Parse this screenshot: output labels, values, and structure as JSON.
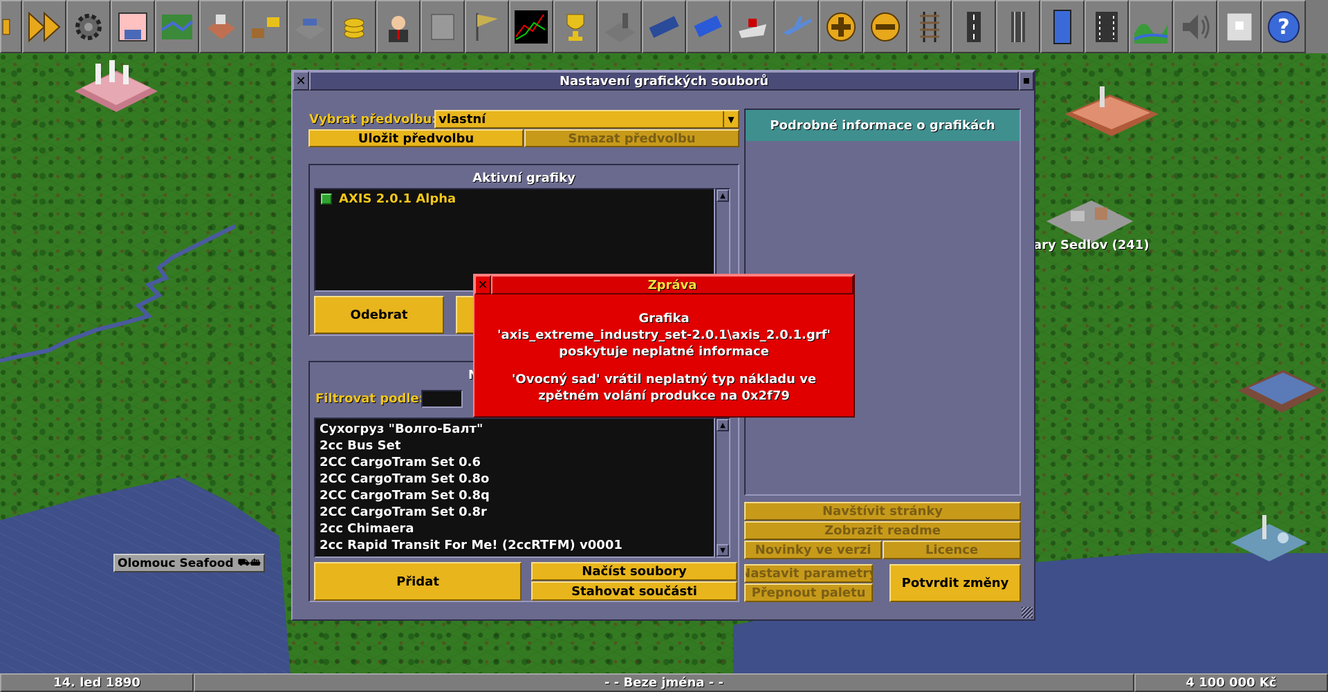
{
  "toolbar": {
    "buttons": [
      {
        "name": "pause-button",
        "icon": "pause-icon"
      },
      {
        "name": "fast-forward-button",
        "icon": "fast-forward-icon"
      },
      {
        "name": "settings-button",
        "icon": "gear-icon"
      },
      {
        "name": "save-button",
        "icon": "floppy-disk-icon"
      },
      {
        "name": "world-map-button",
        "icon": "map-icon"
      },
      {
        "name": "town-directory-button",
        "icon": "town-icon"
      },
      {
        "name": "subsidies-button",
        "icon": "subsidies-icon"
      },
      {
        "name": "station-list-button",
        "icon": "station-icon"
      },
      {
        "name": "finances-button",
        "icon": "coins-icon"
      },
      {
        "name": "company-button",
        "icon": "company-manager-icon"
      },
      {
        "name": "story-book-button",
        "icon": "book-icon"
      },
      {
        "name": "goals-button",
        "icon": "flag-icon"
      },
      {
        "name": "graphs-button",
        "icon": "graph-icon"
      },
      {
        "name": "league-table-button",
        "icon": "trophy-icon"
      },
      {
        "name": "industries-button",
        "icon": "factory-icon"
      },
      {
        "name": "trains-button",
        "icon": "train-icon"
      },
      {
        "name": "road-vehicles-button",
        "icon": "bus-icon"
      },
      {
        "name": "ships-button",
        "icon": "ship-icon"
      },
      {
        "name": "aircraft-button",
        "icon": "airplane-icon"
      },
      {
        "name": "zoom-in-button",
        "icon": "zoom-in-icon"
      },
      {
        "name": "zoom-out-button",
        "icon": "zoom-out-icon"
      },
      {
        "name": "build-railway-button",
        "icon": "rail-track-icon"
      },
      {
        "name": "build-road-button",
        "icon": "road-icon"
      },
      {
        "name": "build-tram-button",
        "icon": "tram-track-icon"
      },
      {
        "name": "build-waterways-button",
        "icon": "canal-icon"
      },
      {
        "name": "build-airport-button",
        "icon": "airport-icon"
      },
      {
        "name": "landscaping-button",
        "icon": "landscape-icon"
      },
      {
        "name": "music-button",
        "icon": "speaker-icon"
      },
      {
        "name": "news-button",
        "icon": "newspaper-icon"
      },
      {
        "name": "help-button",
        "icon": "question-icon"
      }
    ]
  },
  "map": {
    "town_label": "ary Sedlov (241)",
    "industry_label": "Olomouc Seafood"
  },
  "newgrf_window": {
    "title": "Nastavení grafických souborů",
    "preset_label": "Vybrat předvolbu:",
    "preset_value": "vlastní",
    "save_preset": "Uložit předvolbu",
    "delete_preset": "Smazat předvolbu",
    "active_header": "Aktivní grafiky",
    "active_items": [
      {
        "label": "AXIS 2.0.1 Alpha",
        "status_color": "#2fa32f"
      }
    ],
    "remove_button": "Odebrat",
    "inactive_header_partial": "N",
    "filter_label": "Filtrovat podle:",
    "available_items": [
      "Сухогруз \"Волго-Балт\"",
      "2cc Bus Set",
      "2CC CargoTram Set 0.6",
      "2CC CargoTram Set 0.8o",
      "2CC CargoTram Set 0.8q",
      "2CC CargoTram Set 0.8r",
      "2cc Chimaera",
      "2cc Rapid Transit For Me! (2ccRTFM) v0001"
    ],
    "add_button": "Přidat",
    "load_files_button": "Načíst soubory",
    "download_content_button": "Stahovat součásti",
    "details_header": "Podrobné informace o grafikách",
    "visit_website_button": "Navštívit stránky",
    "show_readme_button": "Zobrazit readme",
    "changelog_button": "Novinky ve verzi",
    "license_button": "Licence",
    "set_parameters_button": "Nastavit parametry",
    "toggle_palette_button": "Přepnout paletu",
    "apply_changes_button": "Potvrdit změny"
  },
  "message": {
    "title": "Zpráva",
    "lines": [
      "Grafika",
      "'axis_extreme_industry_set-2.0.1\\axis_2.0.1.grf'",
      "poskytuje neplatné informace",
      "'Ovocný sad' vrátil neplatný typ nákladu ve",
      "zpětném volání produkce na 0x2f79"
    ]
  },
  "statusbar": {
    "date": "14. led 1890",
    "news": "- -  Beze jména  - -",
    "money": "4 100 000 Kč"
  },
  "colors": {
    "window_bg": "#6a6a8e",
    "button_yellow": "#e8b51c",
    "error_red": "#e00000",
    "details_header_bg": "#3f8f8f"
  }
}
